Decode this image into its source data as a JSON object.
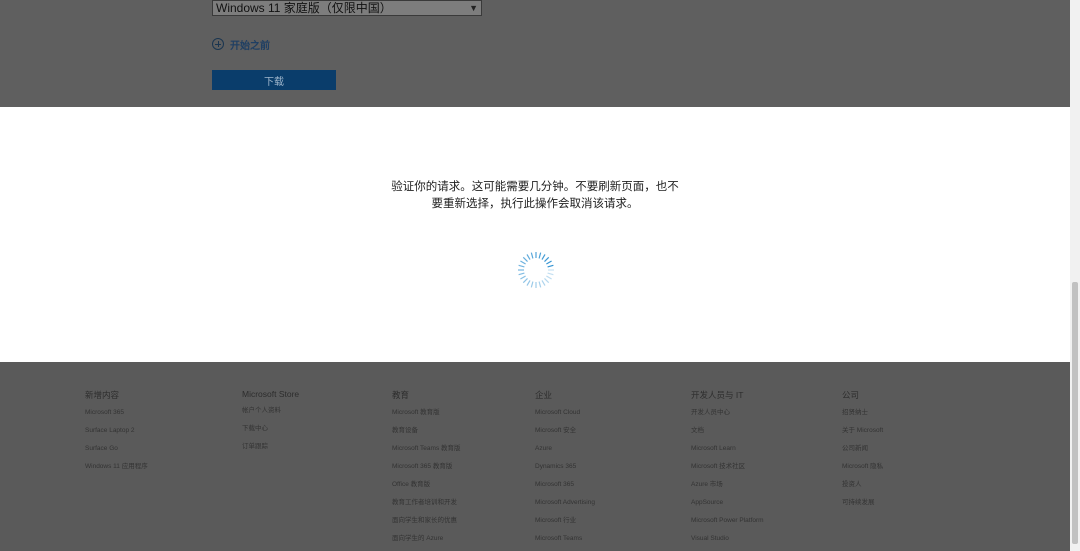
{
  "top": {
    "edition_select_value": "Windows 11 家庭版（仅限中国）",
    "begin_label": "开始之前",
    "download_label": "下载"
  },
  "modal": {
    "message": "验证你的请求。这可能需要几分钟。不要刷新页面，也不要重新选择，执行此操作会取消该请求。"
  },
  "footer": {
    "columns": [
      {
        "title": "新增内容",
        "items": [
          "Microsoft 365",
          "Surface Laptop 2",
          "Surface Go",
          "Windows 11 应用程序"
        ]
      },
      {
        "title": "Microsoft Store",
        "items": [
          "帐户个人资料",
          "下载中心",
          "订单跟踪"
        ]
      },
      {
        "title": "教育",
        "items": [
          "Microsoft 教育版",
          "教育设备",
          "Microsoft Teams 教育版",
          "Microsoft 365 教育版",
          "Office 教育版",
          "教育工作者培训和开发",
          "面向学生和家长的优惠",
          "面向学生的 Azure"
        ]
      },
      {
        "title": "企业",
        "items": [
          "Microsoft Cloud",
          "Microsoft 安全",
          "Azure",
          "Dynamics 365",
          "Microsoft 365",
          "Microsoft Advertising",
          "Microsoft 行业",
          "Microsoft Teams"
        ]
      },
      {
        "title": "开发人员与 IT",
        "items": [
          "开发人员中心",
          "文档",
          "Microsoft Learn",
          "Microsoft 技术社区",
          "Azure 市场",
          "AppSource",
          "Microsoft Power Platform",
          "Visual Studio"
        ]
      },
      {
        "title": "公司",
        "items": [
          "招贤纳士",
          "关于 Microsoft",
          "公司新闻",
          "Microsoft 隐私",
          "投资人",
          "可持续发展"
        ]
      }
    ]
  },
  "colors": {
    "accent": "#0a3d6b",
    "spinner": "#2b8fd0"
  },
  "icons": {
    "begin": "plus-circle-icon",
    "select_caret": "chevron-down-icon",
    "loading": "loading-spinner-icon"
  }
}
